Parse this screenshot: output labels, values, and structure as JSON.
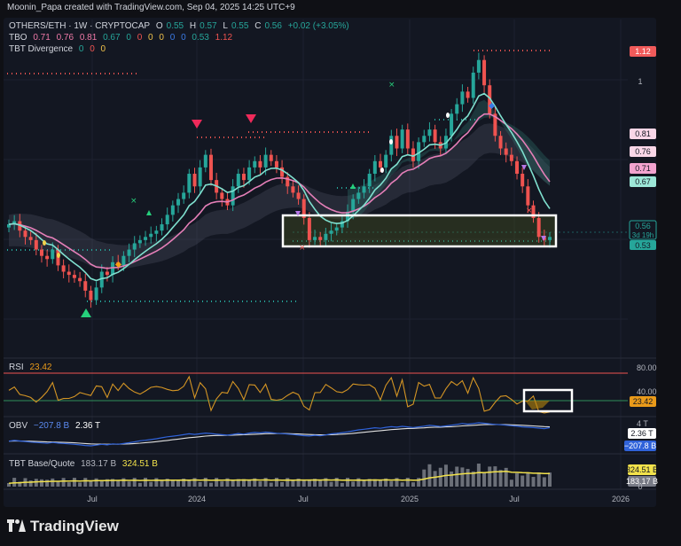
{
  "credit": "Moonin_Papa created with TradingView.com, Sep 04, 2025 14:25 UTC+9",
  "legend": {
    "symbol": "OTHERS/ETH · 1W · CRYPTOCAP",
    "o_label": "O",
    "o": "0.55",
    "h_label": "H",
    "h": "0.57",
    "l_label": "L",
    "l": "0.55",
    "c_label": "C",
    "c": "0.56",
    "change": "+0.02 (+3.05%)",
    "tbo_label": "TBO",
    "tbo_values": [
      "0.71",
      "0.76",
      "0.81",
      "0.67",
      "0",
      "0",
      "0",
      "0",
      "0",
      "0",
      "0.53",
      "1.12"
    ],
    "tbt_div_label": "TBT Divergence",
    "tbt_div_values": [
      "0",
      "0",
      "0"
    ]
  },
  "colors": {
    "up": "#26a69a",
    "down": "#ef5350",
    "ema_fast": "#7fe0cf",
    "ema_slow": "#e57fb8",
    "rsi": "#d49524",
    "obv": "#2f62d9",
    "obv_ma": "#e0e0e0",
    "tbt": "#f2e24b",
    "box": "#ffffff"
  },
  "price_scale": [
    "1.12",
    "1",
    "0.81",
    "0.76",
    "0.71",
    "0.67",
    "0.56",
    "3d 19h",
    "0.53"
  ],
  "rsi_pane": {
    "label": "RSI",
    "value": "23.42",
    "upper": "80.00",
    "lower": "40.00",
    "current": "23.42"
  },
  "obv_pane": {
    "label": "OBV",
    "value1": "−207.8 B",
    "value2": "2.36 T",
    "scale_top": "4 T",
    "scale_1": "2.36 T",
    "scale_2": "−207.8 B"
  },
  "tbt_pane": {
    "label": "TBT Base/Quote",
    "value1": "183.17 B",
    "value2": "324.51 B",
    "scale_1": "324.51 B",
    "scale_2": "183.17 B",
    "scale_zero": "0"
  },
  "time_axis": [
    "Jul",
    "2024",
    "Jul",
    "2025",
    "Jul",
    "2026"
  ],
  "branding": "TradingView",
  "chart_data": {
    "type": "candlestick",
    "title": "OTHERS/ETH · 1W · CRYPTOCAP",
    "interval": "1W",
    "x_range": [
      "2023-04",
      "2026-02"
    ],
    "y_range": [
      0.3,
      1.15
    ],
    "levels": {
      "resistance_top": 1.12,
      "support_box_low": 0.53,
      "support_box_high": 0.61,
      "current": 0.56
    },
    "closes": [
      0.6,
      0.61,
      0.58,
      0.56,
      0.55,
      0.52,
      0.5,
      0.49,
      0.52,
      0.47,
      0.45,
      0.44,
      0.43,
      0.42,
      0.39,
      0.36,
      0.4,
      0.45,
      0.44,
      0.48,
      0.47,
      0.5,
      0.52,
      0.54,
      0.55,
      0.56,
      0.57,
      0.58,
      0.6,
      0.63,
      0.66,
      0.68,
      0.7,
      0.76,
      0.72,
      0.78,
      0.82,
      0.74,
      0.7,
      0.68,
      0.66,
      0.72,
      0.76,
      0.74,
      0.78,
      0.8,
      0.78,
      0.82,
      0.8,
      0.78,
      0.75,
      0.72,
      0.7,
      0.68,
      0.62,
      0.55,
      0.56,
      0.55,
      0.57,
      0.58,
      0.59,
      0.61,
      0.64,
      0.68,
      0.7,
      0.72,
      0.76,
      0.8,
      0.78,
      0.82,
      0.88,
      0.84,
      0.9,
      0.84,
      0.8,
      0.86,
      0.88,
      0.9,
      0.86,
      0.84,
      0.88,
      0.95,
      0.98,
      1.02,
      1.0,
      1.08,
      1.12,
      1.04,
      0.95,
      0.88,
      0.84,
      0.82,
      0.8,
      0.76,
      0.72,
      0.66,
      0.62,
      0.56,
      0.55,
      0.56
    ],
    "rsi": {
      "upper": 80,
      "lower": 40,
      "current": 23.42
    },
    "obv": {
      "current": "-207.8 B",
      "ma": "2.36 T"
    },
    "tbt_base_quote": {
      "value1": "183.17 B",
      "value2": "324.51 B"
    }
  }
}
